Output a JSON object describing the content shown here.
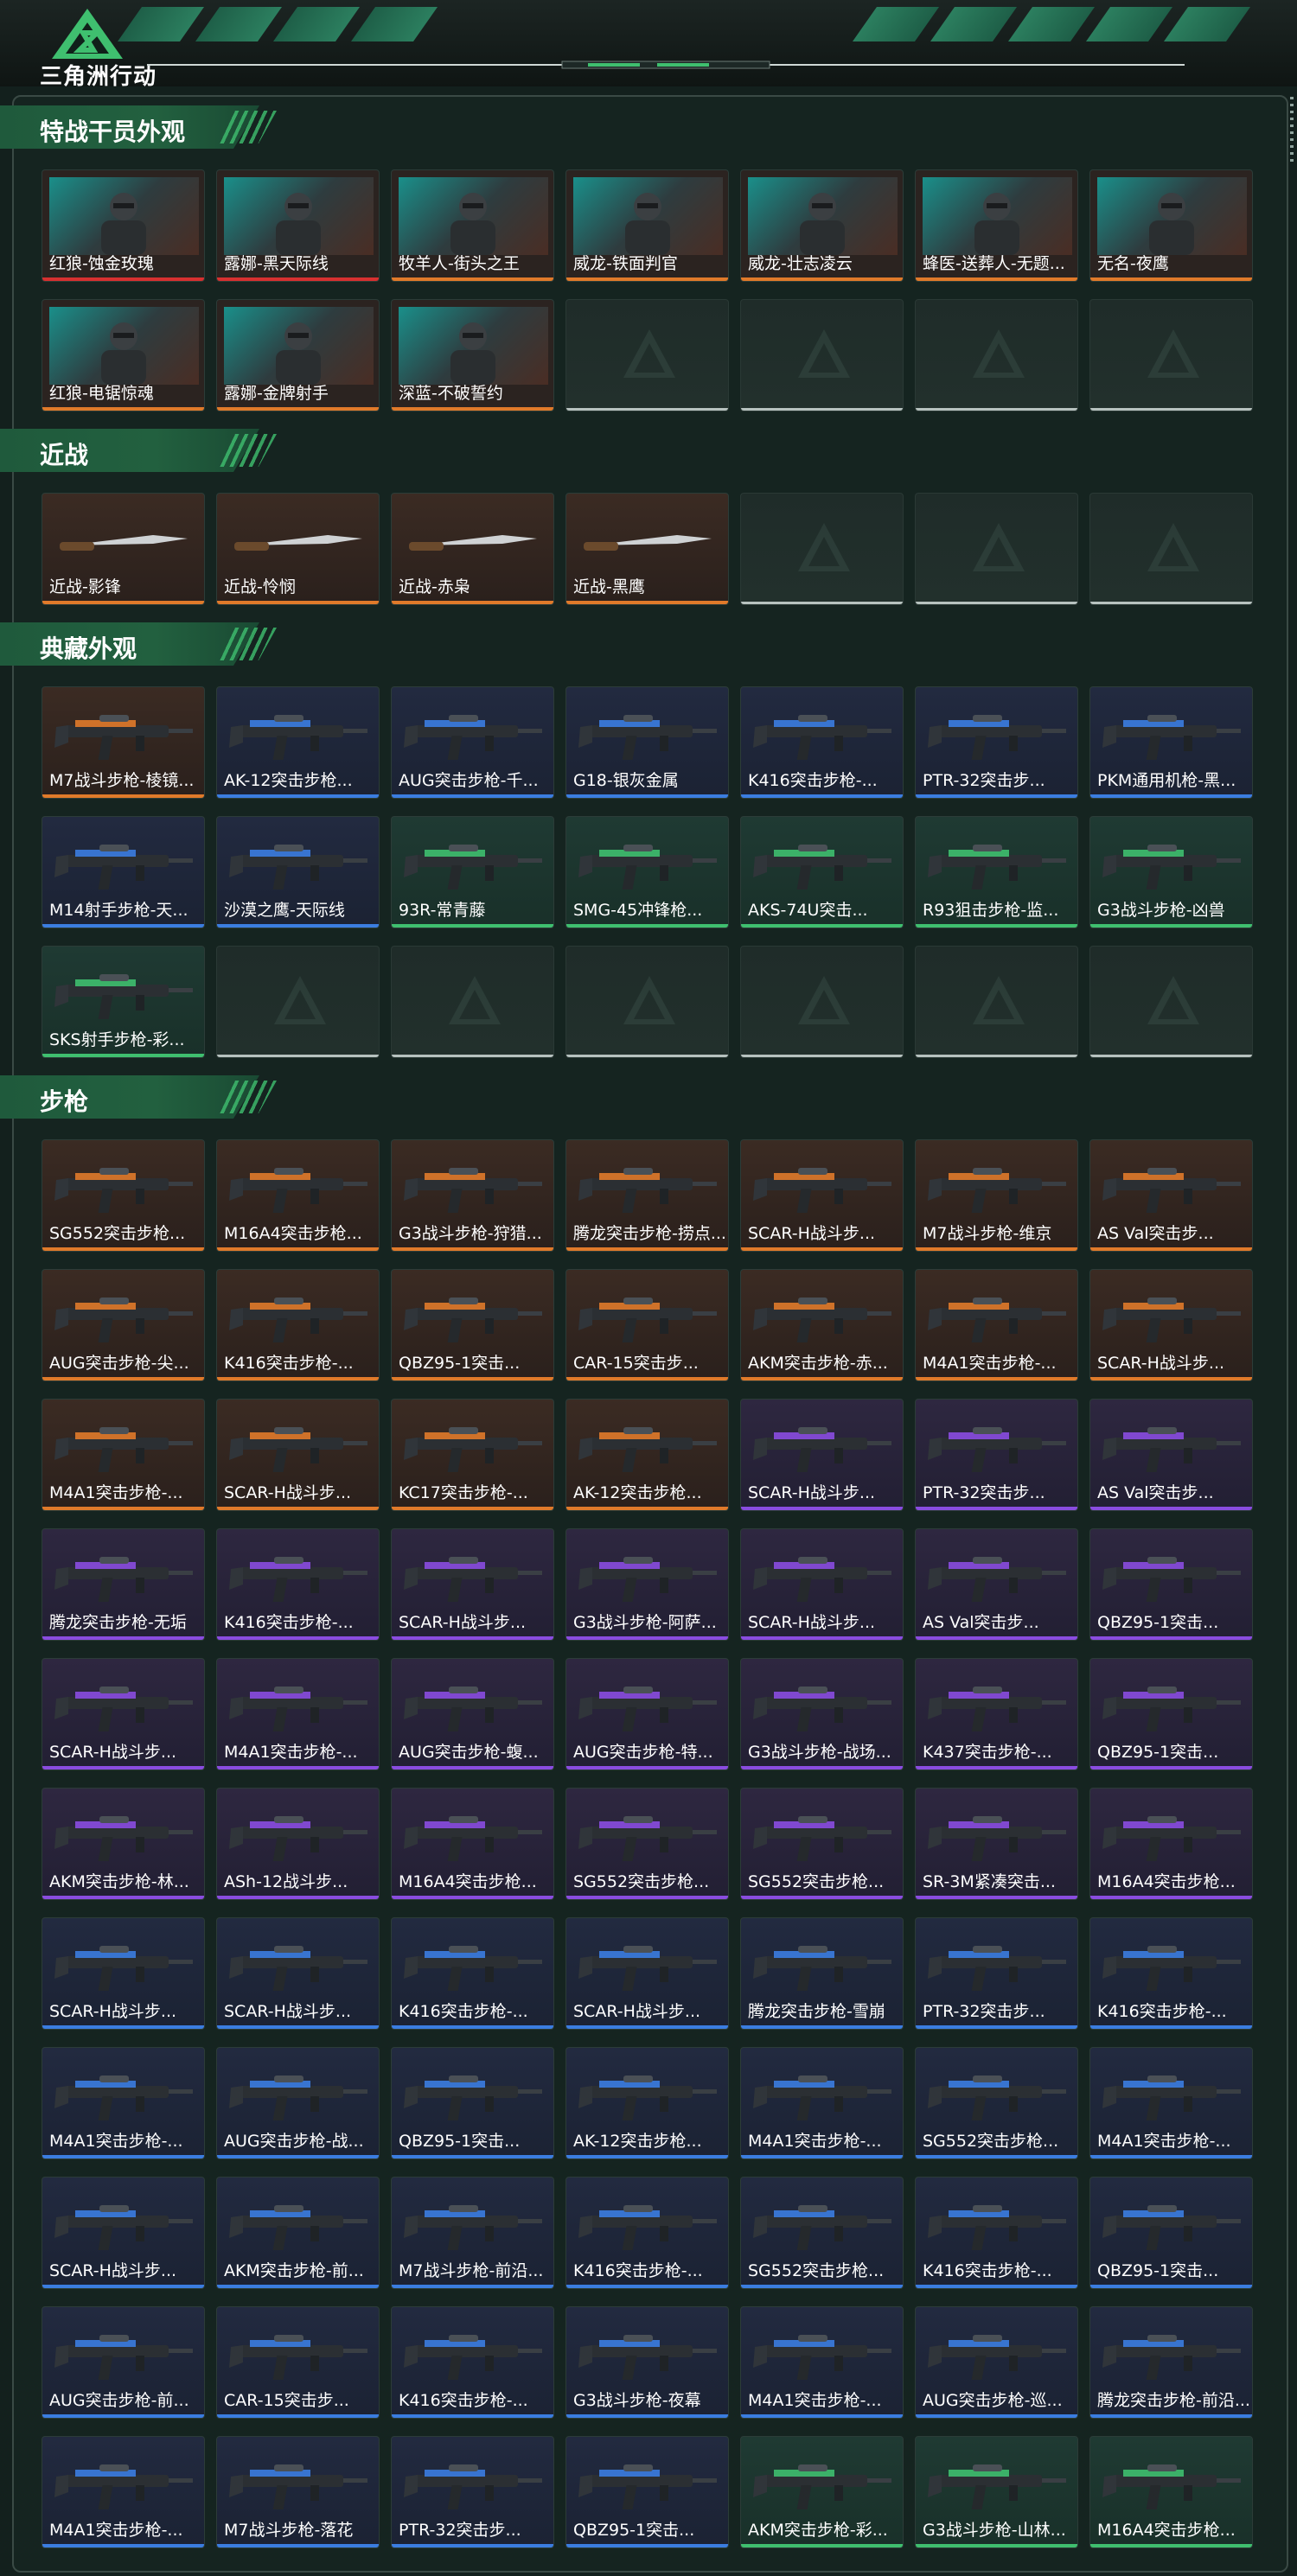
{
  "app": {
    "logo_text": "三角洲行动"
  },
  "colors": {
    "accent": "#3fbf6f",
    "orange": "#e07a2a",
    "blue": "#3b7de0",
    "purple": "#8a4ce0",
    "green": "#3fbf6f"
  },
  "sections": [
    {
      "title": "特战干员外观",
      "items": [
        {
          "name": "红狼-蚀金玫瑰",
          "rarity": "red",
          "kind": "operator"
        },
        {
          "name": "露娜-黑天际线",
          "rarity": "red",
          "kind": "operator"
        },
        {
          "name": "牧羊人-街头之王",
          "rarity": "orange",
          "kind": "operator"
        },
        {
          "name": "威龙-铁面判官",
          "rarity": "orange",
          "kind": "operator"
        },
        {
          "name": "威龙-壮志凌云",
          "rarity": "orange",
          "kind": "operator"
        },
        {
          "name": "蜂医-送葬人-无题...",
          "rarity": "orange",
          "kind": "operator"
        },
        {
          "name": "无名-夜鹰",
          "rarity": "orange",
          "kind": "operator"
        },
        {
          "name": "红狼-电锯惊魂",
          "rarity": "orange",
          "kind": "operator"
        },
        {
          "name": "露娜-金牌射手",
          "rarity": "orange",
          "kind": "operator"
        },
        {
          "name": "深蓝-不破誓约",
          "rarity": "orange",
          "kind": "operator"
        },
        {
          "name": "",
          "rarity": "empty"
        },
        {
          "name": "",
          "rarity": "empty"
        },
        {
          "name": "",
          "rarity": "empty"
        },
        {
          "name": "",
          "rarity": "empty"
        }
      ]
    },
    {
      "title": "近战",
      "items": [
        {
          "name": "近战-影锋",
          "rarity": "orange",
          "kind": "knife"
        },
        {
          "name": "近战-怜悯",
          "rarity": "orange",
          "kind": "knife"
        },
        {
          "name": "近战-赤枭",
          "rarity": "orange",
          "kind": "knife"
        },
        {
          "name": "近战-黑鹰",
          "rarity": "orange",
          "kind": "knife"
        },
        {
          "name": "",
          "rarity": "empty"
        },
        {
          "name": "",
          "rarity": "empty"
        },
        {
          "name": "",
          "rarity": "empty"
        }
      ]
    },
    {
      "title": "典藏外观",
      "items": [
        {
          "name": "M7战斗步枪-棱镜...",
          "rarity": "orange",
          "kind": "gun"
        },
        {
          "name": "AK-12突击步枪...",
          "rarity": "blue",
          "kind": "gun"
        },
        {
          "name": "AUG突击步枪-千...",
          "rarity": "blue",
          "kind": "gun"
        },
        {
          "name": "G18-银灰金属",
          "rarity": "blue",
          "kind": "gun"
        },
        {
          "name": "K416突击步枪-...",
          "rarity": "blue",
          "kind": "gun"
        },
        {
          "name": "PTR-32突击步...",
          "rarity": "blue",
          "kind": "gun"
        },
        {
          "name": "PKM通用机枪-黑...",
          "rarity": "blue",
          "kind": "gun"
        },
        {
          "name": "M14射手步枪-天...",
          "rarity": "blue",
          "kind": "gun"
        },
        {
          "name": "沙漠之鹰-天际线",
          "rarity": "blue",
          "kind": "gun"
        },
        {
          "name": "93R-常青藤",
          "rarity": "green",
          "kind": "gun"
        },
        {
          "name": "SMG-45冲锋枪...",
          "rarity": "green",
          "kind": "gun"
        },
        {
          "name": "AKS-74U突击...",
          "rarity": "green",
          "kind": "gun"
        },
        {
          "name": "R93狙击步枪-监...",
          "rarity": "green",
          "kind": "gun"
        },
        {
          "name": "G3战斗步枪-凶兽",
          "rarity": "green",
          "kind": "gun"
        },
        {
          "name": "SKS射手步枪-彩...",
          "rarity": "green",
          "kind": "gun"
        },
        {
          "name": "",
          "rarity": "empty"
        },
        {
          "name": "",
          "rarity": "empty"
        },
        {
          "name": "",
          "rarity": "empty"
        },
        {
          "name": "",
          "rarity": "empty"
        },
        {
          "name": "",
          "rarity": "empty"
        },
        {
          "name": "",
          "rarity": "empty"
        }
      ]
    },
    {
      "title": "步枪",
      "items": [
        {
          "name": "SG552突击步枪...",
          "rarity": "orange",
          "kind": "gun"
        },
        {
          "name": "M16A4突击步枪...",
          "rarity": "orange",
          "kind": "gun"
        },
        {
          "name": "G3战斗步枪-狩猎...",
          "rarity": "orange",
          "kind": "gun"
        },
        {
          "name": "腾龙突击步枪-捞点...",
          "rarity": "orange",
          "kind": "gun"
        },
        {
          "name": "SCAR-H战斗步...",
          "rarity": "orange",
          "kind": "gun"
        },
        {
          "name": "M7战斗步枪-维京",
          "rarity": "orange",
          "kind": "gun"
        },
        {
          "name": "AS Val突击步...",
          "rarity": "orange",
          "kind": "gun"
        },
        {
          "name": "AUG突击步枪-尖...",
          "rarity": "orange",
          "kind": "gun"
        },
        {
          "name": "K416突击步枪-...",
          "rarity": "orange",
          "kind": "gun"
        },
        {
          "name": "QBZ95-1突击...",
          "rarity": "orange",
          "kind": "gun"
        },
        {
          "name": "CAR-15突击步...",
          "rarity": "orange",
          "kind": "gun"
        },
        {
          "name": "AKM突击步枪-赤...",
          "rarity": "orange",
          "kind": "gun"
        },
        {
          "name": "M4A1突击步枪-...",
          "rarity": "orange",
          "kind": "gun"
        },
        {
          "name": "SCAR-H战斗步...",
          "rarity": "orange",
          "kind": "gun"
        },
        {
          "name": "M4A1突击步枪-...",
          "rarity": "orange",
          "kind": "gun"
        },
        {
          "name": "SCAR-H战斗步...",
          "rarity": "orange",
          "kind": "gun"
        },
        {
          "name": "KC17突击步枪-...",
          "rarity": "orange",
          "kind": "gun"
        },
        {
          "name": "AK-12突击步枪...",
          "rarity": "orange",
          "kind": "gun"
        },
        {
          "name": "SCAR-H战斗步...",
          "rarity": "purple",
          "kind": "gun"
        },
        {
          "name": "PTR-32突击步...",
          "rarity": "purple",
          "kind": "gun"
        },
        {
          "name": "AS Val突击步...",
          "rarity": "purple",
          "kind": "gun"
        },
        {
          "name": "腾龙突击步枪-无垢",
          "rarity": "purple",
          "kind": "gun"
        },
        {
          "name": "K416突击步枪-...",
          "rarity": "purple",
          "kind": "gun"
        },
        {
          "name": "SCAR-H战斗步...",
          "rarity": "purple",
          "kind": "gun"
        },
        {
          "name": "G3战斗步枪-阿萨...",
          "rarity": "purple",
          "kind": "gun"
        },
        {
          "name": "SCAR-H战斗步...",
          "rarity": "purple",
          "kind": "gun"
        },
        {
          "name": "AS Val突击步...",
          "rarity": "purple",
          "kind": "gun"
        },
        {
          "name": "QBZ95-1突击...",
          "rarity": "purple",
          "kind": "gun"
        },
        {
          "name": "SCAR-H战斗步...",
          "rarity": "purple",
          "kind": "gun"
        },
        {
          "name": "M4A1突击步枪-...",
          "rarity": "purple",
          "kind": "gun"
        },
        {
          "name": "AUG突击步枪-蝮...",
          "rarity": "purple",
          "kind": "gun"
        },
        {
          "name": "AUG突击步枪-特...",
          "rarity": "purple",
          "kind": "gun"
        },
        {
          "name": "G3战斗步枪-战场...",
          "rarity": "purple",
          "kind": "gun"
        },
        {
          "name": "K437突击步枪-...",
          "rarity": "purple",
          "kind": "gun"
        },
        {
          "name": "QBZ95-1突击...",
          "rarity": "purple",
          "kind": "gun"
        },
        {
          "name": "AKM突击步枪-林...",
          "rarity": "purple",
          "kind": "gun"
        },
        {
          "name": "ASh-12战斗步...",
          "rarity": "purple",
          "kind": "gun"
        },
        {
          "name": "M16A4突击步枪...",
          "rarity": "purple",
          "kind": "gun"
        },
        {
          "name": "SG552突击步枪...",
          "rarity": "purple",
          "kind": "gun"
        },
        {
          "name": "SG552突击步枪...",
          "rarity": "purple",
          "kind": "gun"
        },
        {
          "name": "SR-3M紧凑突击...",
          "rarity": "purple",
          "kind": "gun"
        },
        {
          "name": "M16A4突击步枪...",
          "rarity": "purple",
          "kind": "gun"
        },
        {
          "name": "SCAR-H战斗步...",
          "rarity": "blue",
          "kind": "gun"
        },
        {
          "name": "SCAR-H战斗步...",
          "rarity": "blue",
          "kind": "gun"
        },
        {
          "name": "K416突击步枪-...",
          "rarity": "blue",
          "kind": "gun"
        },
        {
          "name": "SCAR-H战斗步...",
          "rarity": "blue",
          "kind": "gun"
        },
        {
          "name": "腾龙突击步枪-雪崩",
          "rarity": "blue",
          "kind": "gun"
        },
        {
          "name": "PTR-32突击步...",
          "rarity": "blue",
          "kind": "gun"
        },
        {
          "name": "K416突击步枪-...",
          "rarity": "blue",
          "kind": "gun"
        },
        {
          "name": "M4A1突击步枪-...",
          "rarity": "blue",
          "kind": "gun"
        },
        {
          "name": "AUG突击步枪-战...",
          "rarity": "blue",
          "kind": "gun"
        },
        {
          "name": "QBZ95-1突击...",
          "rarity": "blue",
          "kind": "gun"
        },
        {
          "name": "AK-12突击步枪...",
          "rarity": "blue",
          "kind": "gun"
        },
        {
          "name": "M4A1突击步枪-...",
          "rarity": "blue",
          "kind": "gun"
        },
        {
          "name": "SG552突击步枪...",
          "rarity": "blue",
          "kind": "gun"
        },
        {
          "name": "M4A1突击步枪-...",
          "rarity": "blue",
          "kind": "gun"
        },
        {
          "name": "SCAR-H战斗步...",
          "rarity": "blue",
          "kind": "gun"
        },
        {
          "name": "AKM突击步枪-前...",
          "rarity": "blue",
          "kind": "gun"
        },
        {
          "name": "M7战斗步枪-前沿...",
          "rarity": "blue",
          "kind": "gun"
        },
        {
          "name": "K416突击步枪-...",
          "rarity": "blue",
          "kind": "gun"
        },
        {
          "name": "SG552突击步枪...",
          "rarity": "blue",
          "kind": "gun"
        },
        {
          "name": "K416突击步枪-...",
          "rarity": "blue",
          "kind": "gun"
        },
        {
          "name": "QBZ95-1突击...",
          "rarity": "blue",
          "kind": "gun"
        },
        {
          "name": "AUG突击步枪-前...",
          "rarity": "blue",
          "kind": "gun"
        },
        {
          "name": "CAR-15突击步...",
          "rarity": "blue",
          "kind": "gun"
        },
        {
          "name": "K416突击步枪-...",
          "rarity": "blue",
          "kind": "gun"
        },
        {
          "name": "G3战斗步枪-夜幕",
          "rarity": "blue",
          "kind": "gun"
        },
        {
          "name": "M4A1突击步枪-...",
          "rarity": "blue",
          "kind": "gun"
        },
        {
          "name": "AUG突击步枪-巡...",
          "rarity": "blue",
          "kind": "gun"
        },
        {
          "name": "腾龙突击步枪-前沿...",
          "rarity": "blue",
          "kind": "gun"
        },
        {
          "name": "M4A1突击步枪-...",
          "rarity": "blue",
          "kind": "gun"
        },
        {
          "name": "M7战斗步枪-落花",
          "rarity": "blue",
          "kind": "gun"
        },
        {
          "name": "PTR-32突击步...",
          "rarity": "blue",
          "kind": "gun"
        },
        {
          "name": "QBZ95-1突击...",
          "rarity": "blue",
          "kind": "gun"
        },
        {
          "name": "AKM突击步枪-彩...",
          "rarity": "green",
          "kind": "gun"
        },
        {
          "name": "G3战斗步枪-山林...",
          "rarity": "green",
          "kind": "gun"
        },
        {
          "name": "M16A4突击步枪...",
          "rarity": "green",
          "kind": "gun"
        }
      ]
    }
  ]
}
